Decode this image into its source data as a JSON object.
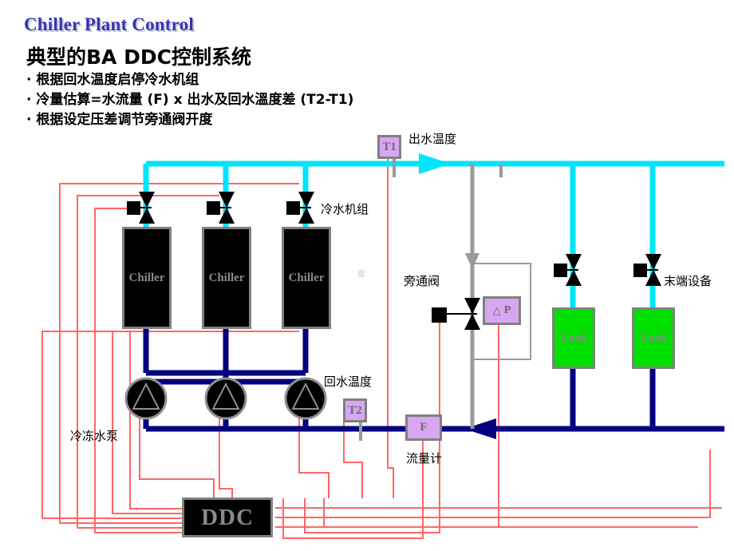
{
  "slide": {
    "header": "Chiller Plant Control",
    "subtitle": "典型的BA DDC控制系统",
    "bullets": [
      "· 根据回水温度启停冷水机组",
      "· 冷量估算=水流量 (F) x 出水及回水溫度差 (T2-T1)",
      "· 根据设定压差调节旁通阀开度"
    ]
  },
  "diagram": {
    "equipment": {
      "chiller_label": "Chiller",
      "load_label": "Load",
      "controller_label": "DDC",
      "chiller_group_label": "冷水机组",
      "pump_group_label": "冷冻水泵",
      "terminal_label": "末端设备",
      "bypass_valve_label": "旁通阀",
      "flow_meter_label": "流量计",
      "supply_temp_label": "出水温度",
      "return_temp_label": "回水温度"
    },
    "sensors": {
      "supply_temp_tag": "T1",
      "return_temp_tag": "T2",
      "flow_tag": "F",
      "dp_tag": "P",
      "dp_symbol": "△"
    },
    "colors": {
      "supply_pipe": "#00e5ff",
      "return_pipe": "#000080",
      "control_wire": "#ff6666",
      "equipment_outline": "#808080",
      "chiller_fill": "#000000",
      "load_fill": "#00e000",
      "sensor_fill": "#d9a6f2",
      "title": "#3333bb"
    },
    "counts": {
      "chillers": 3,
      "pumps": 3,
      "loads": 2
    }
  }
}
